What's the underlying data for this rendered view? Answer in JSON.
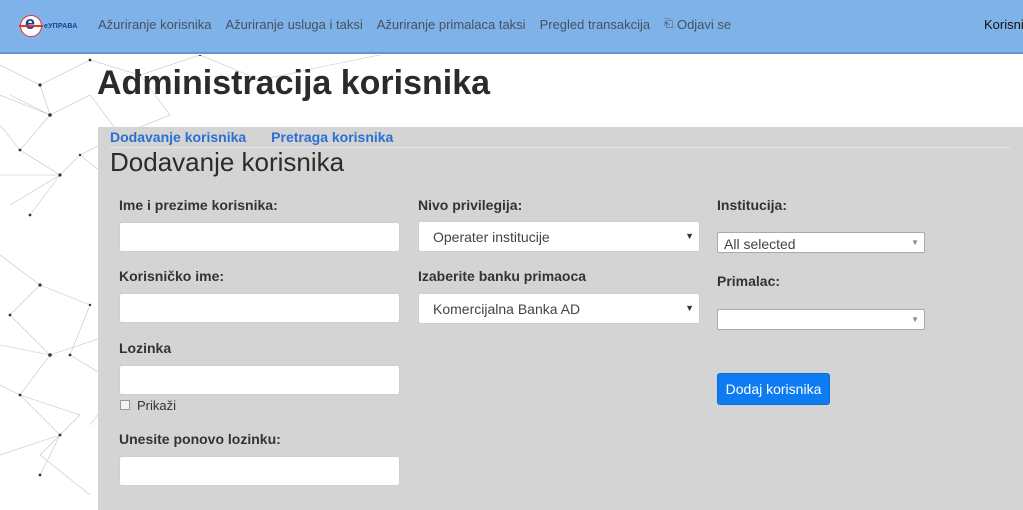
{
  "nav": {
    "logo_text": "еУПРАВА",
    "items": [
      {
        "label": "Ažuriranje korisnika"
      },
      {
        "label": "Ažuriranje usluga i taksi"
      },
      {
        "label": "Ažuriranje primalaca taksi"
      },
      {
        "label": "Pregled transakcija"
      }
    ],
    "logout_label": "Odjavi se",
    "user_label": "Korisnič"
  },
  "page": {
    "title": "Administracija korisnika"
  },
  "tabs": [
    {
      "label": "Dodavanje korisnika"
    },
    {
      "label": "Pretraga korisnika"
    }
  ],
  "form": {
    "section_title": "Dodavanje korisnika",
    "full_name": {
      "label": "Ime i prezime korisnika:",
      "value": ""
    },
    "username": {
      "label": "Korisničko ime:",
      "value": ""
    },
    "password": {
      "label": "Lozinka",
      "value": "",
      "show_label": "Prikaži",
      "show_checked": false
    },
    "password_repeat": {
      "label": "Unesite ponovo lozinku:",
      "value": ""
    },
    "privilege": {
      "label": "Nivo privilegija:",
      "selected": "Operater institucije"
    },
    "bank": {
      "label": "Izaberite banku primaoca",
      "selected": "Komercijalna Banka AD"
    },
    "institution": {
      "label": "Institucija:",
      "selected": "All selected"
    },
    "recipient": {
      "label": "Primalac:",
      "selected": ""
    },
    "submit_label": "Dodaj korisnika"
  },
  "colors": {
    "navbar": "#7eb2e9",
    "panel": "#d4d4d4",
    "link": "#2a6fd4",
    "button": "#0d7cf2"
  }
}
